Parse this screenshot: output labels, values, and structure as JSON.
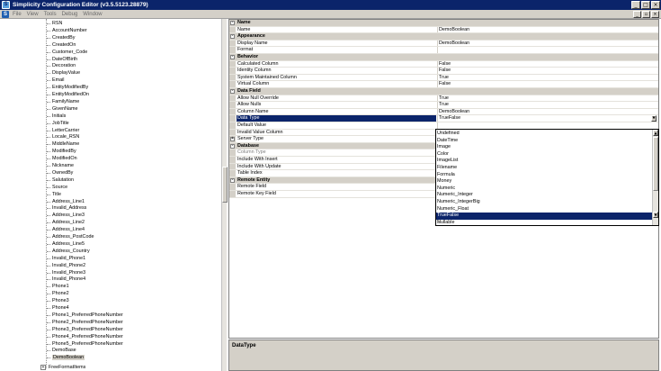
{
  "window": {
    "title": "Simplicity Configuration Editor (v3.5.5123.28879)",
    "minimize": "_",
    "maximize": "□",
    "close": "×"
  },
  "menu": {
    "items": [
      "File",
      "View",
      "Tools",
      "Debug",
      "Window"
    ],
    "mdi_min": "_",
    "mdi_restore": "▫",
    "mdi_close": "×"
  },
  "tree": {
    "items": [
      "RSN",
      "AccountNumber",
      "CreatedBy",
      "CreatedOn",
      "Customer_Code",
      "DateOfBirth",
      "Decoration",
      "DisplayValue",
      "Email",
      "EntityModifiedBy",
      "EntityModifiedOn",
      "FamilyName",
      "GivenName",
      "Initials",
      "JobTitle",
      "LetterCarrier",
      "Locale_RSN",
      "MiddleName",
      "ModifiedBy",
      "ModifiedOn",
      "Nickname",
      "OwnedBy",
      "Salutation",
      "Source",
      "Title",
      "Address_Line1",
      "Invalid_Address",
      "Address_Line3",
      "Address_Line2",
      "Address_Line4",
      "Address_PostCode",
      "Address_Line5",
      "Address_Country",
      "Invalid_Phone1",
      "Invalid_Phone2",
      "Invalid_Phone3",
      "Invalid_Phone4",
      "Phone1",
      "Phone2",
      "Phone3",
      "Phone4",
      "Phone1_PreferredPhoneNumber",
      "Phone2_PreferredPhoneNumber",
      "Phone3_PreferredPhoneNumber",
      "Phone4_PreferredPhoneNumber",
      "Phone5_PreferredPhoneNumber",
      "DemoBase",
      "DemoBoolean"
    ],
    "selected_index": 47,
    "bottom_item": "FreeFormatItems",
    "bottom_toggle": "+"
  },
  "grid": {
    "rows": [
      {
        "type": "cat",
        "label": "Name",
        "toggle": "-"
      },
      {
        "type": "prop",
        "label": "Name",
        "value": "DemoBoolean"
      },
      {
        "type": "cat",
        "label": "Appearance",
        "toggle": "-"
      },
      {
        "type": "prop",
        "label": "Display Name",
        "value": "DemoBoolean"
      },
      {
        "type": "prop",
        "label": "Format",
        "value": ""
      },
      {
        "type": "cat",
        "label": "Behavior",
        "toggle": "-"
      },
      {
        "type": "prop",
        "label": "Calculated Column",
        "value": "False"
      },
      {
        "type": "prop",
        "label": "Identity Column",
        "value": "False"
      },
      {
        "type": "prop",
        "label": "System Maintained Column",
        "value": "True"
      },
      {
        "type": "prop",
        "label": "Virtual Column",
        "value": "False"
      },
      {
        "type": "cat",
        "label": "Data Field",
        "toggle": "-"
      },
      {
        "type": "prop",
        "label": "Allow Null Override",
        "value": "True"
      },
      {
        "type": "prop",
        "label": "Allow Nulls",
        "value": "True"
      },
      {
        "type": "prop",
        "label": "Column Name",
        "value": "DemoBoolean"
      },
      {
        "type": "selected",
        "label": "Data Type",
        "value": "TrueFalse"
      },
      {
        "type": "prop",
        "label": "Default Value",
        "value": ""
      },
      {
        "type": "prop",
        "label": "Invalid Value Column",
        "value": ""
      },
      {
        "type": "expand",
        "label": "Server Type",
        "value": "",
        "toggle": "+"
      },
      {
        "type": "cat",
        "label": "Database",
        "toggle": "-"
      },
      {
        "type": "disabled",
        "label": "Column Type",
        "value": ""
      },
      {
        "type": "prop",
        "label": "Include With Insert",
        "value": ""
      },
      {
        "type": "prop",
        "label": "Include With Update",
        "value": ""
      },
      {
        "type": "prop",
        "label": "Table Index",
        "value": ""
      },
      {
        "type": "cat",
        "label": "Remote Entity",
        "toggle": "-"
      },
      {
        "type": "prop",
        "label": "Remote Field",
        "value": ""
      },
      {
        "type": "prop",
        "label": "Remote Key Field",
        "value": ""
      }
    ],
    "combo_arrow": "▼"
  },
  "dropdown": {
    "options": [
      "Undefined",
      "DateTime",
      "Image",
      "Color",
      "ImageList",
      "Filename",
      "Formula",
      "Money",
      "Numeric",
      "Numeric_Integer",
      "Numeric_IntegerBig",
      "Numeric_Float",
      "TrueFalse",
      "Nullable"
    ],
    "selected_index": 12,
    "scroll_up": "▲",
    "scroll_down": "▼",
    "grip": "◢"
  },
  "description": {
    "title": "DataType"
  }
}
